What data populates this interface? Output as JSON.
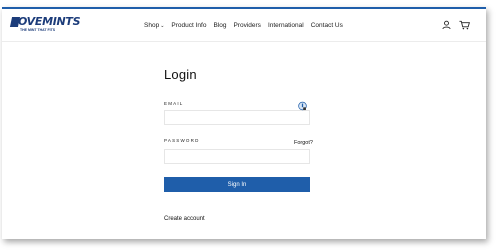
{
  "header": {
    "logo_text": "OVEMINTS",
    "logo_tagline": "THE MINT THAT FITS",
    "nav": [
      {
        "label": "Shop",
        "has_dropdown": true
      },
      {
        "label": "Product Info"
      },
      {
        "label": "Blog"
      },
      {
        "label": "Providers"
      },
      {
        "label": "International"
      },
      {
        "label": "Contact Us"
      }
    ],
    "icons": [
      "user-icon",
      "cart-icon"
    ]
  },
  "login": {
    "title": "Login",
    "email_label": "EMAIL",
    "email_value": "",
    "password_label": "PASSWORD",
    "password_value": "",
    "forgot_label": "Forgot?",
    "signin_label": "Sign In",
    "create_account_label": "Create account"
  },
  "colors": {
    "accent": "#1f5eaa",
    "brand": "#1c3c7a"
  }
}
